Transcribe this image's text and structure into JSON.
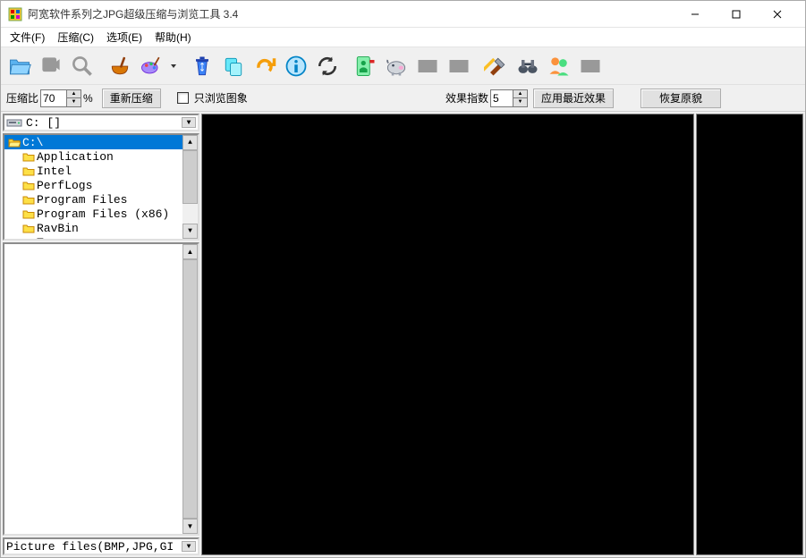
{
  "window": {
    "title": "阿宽软件系列之JPG超级压缩与浏览工具 3.4"
  },
  "menu": {
    "file": "文件(F)",
    "compress": "压缩(C)",
    "options": "选项(E)",
    "help": "帮助(H)"
  },
  "opts": {
    "ratio_label": "压缩比",
    "ratio_value": "70",
    "percent": "%",
    "recompress": "重新压缩",
    "browse_only": "只浏览图象",
    "effect_label": "效果指数",
    "effect_value": "5",
    "apply_effect": "应用最近效果",
    "restore": "恢复原貌"
  },
  "drive": {
    "label": "C: []"
  },
  "dirs": {
    "items": [
      {
        "label": "C:\\",
        "selected": true,
        "indent": false,
        "open": true
      },
      {
        "label": "Application",
        "selected": false,
        "indent": true,
        "open": false
      },
      {
        "label": "Intel",
        "selected": false,
        "indent": true,
        "open": false
      },
      {
        "label": "PerfLogs",
        "selected": false,
        "indent": true,
        "open": false
      },
      {
        "label": "Program Files",
        "selected": false,
        "indent": true,
        "open": false
      },
      {
        "label": "Program Files (x86)",
        "selected": false,
        "indent": true,
        "open": false
      },
      {
        "label": "RavBin",
        "selected": false,
        "indent": true,
        "open": false
      },
      {
        "label": "Temp",
        "selected": false,
        "indent": true,
        "open": false
      }
    ]
  },
  "filter": {
    "text": "Picture files(BMP,JPG,GI"
  }
}
